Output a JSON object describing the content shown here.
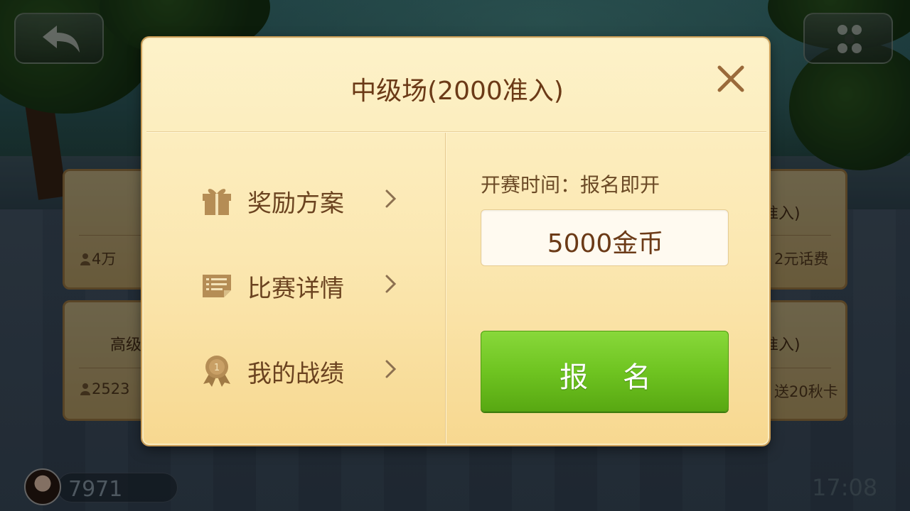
{
  "background": {
    "cards": [
      {
        "stat": "4万"
      },
      {
        "title": "高级",
        "stat": "2523"
      },
      {
        "title": "准入)",
        "reward": "2元话费"
      },
      {
        "title": "准入)",
        "reward": "送20秋卡"
      }
    ],
    "user_coins": "7971",
    "clock": "17:08"
  },
  "modal": {
    "title": "中级场(2000准入)",
    "menu": [
      {
        "label": "奖励方案",
        "icon": "gift-icon"
      },
      {
        "label": "比赛详情",
        "icon": "list-icon"
      },
      {
        "label": "我的战绩",
        "icon": "medal-icon"
      }
    ],
    "start_time": "开赛时间：报名即开",
    "entry_fee": "5000金币",
    "signup_label": "报 名"
  },
  "colors": {
    "modal_bg": "#fbe7b0",
    "title_text": "#6b3a17",
    "signup_green": "#6fc421"
  }
}
